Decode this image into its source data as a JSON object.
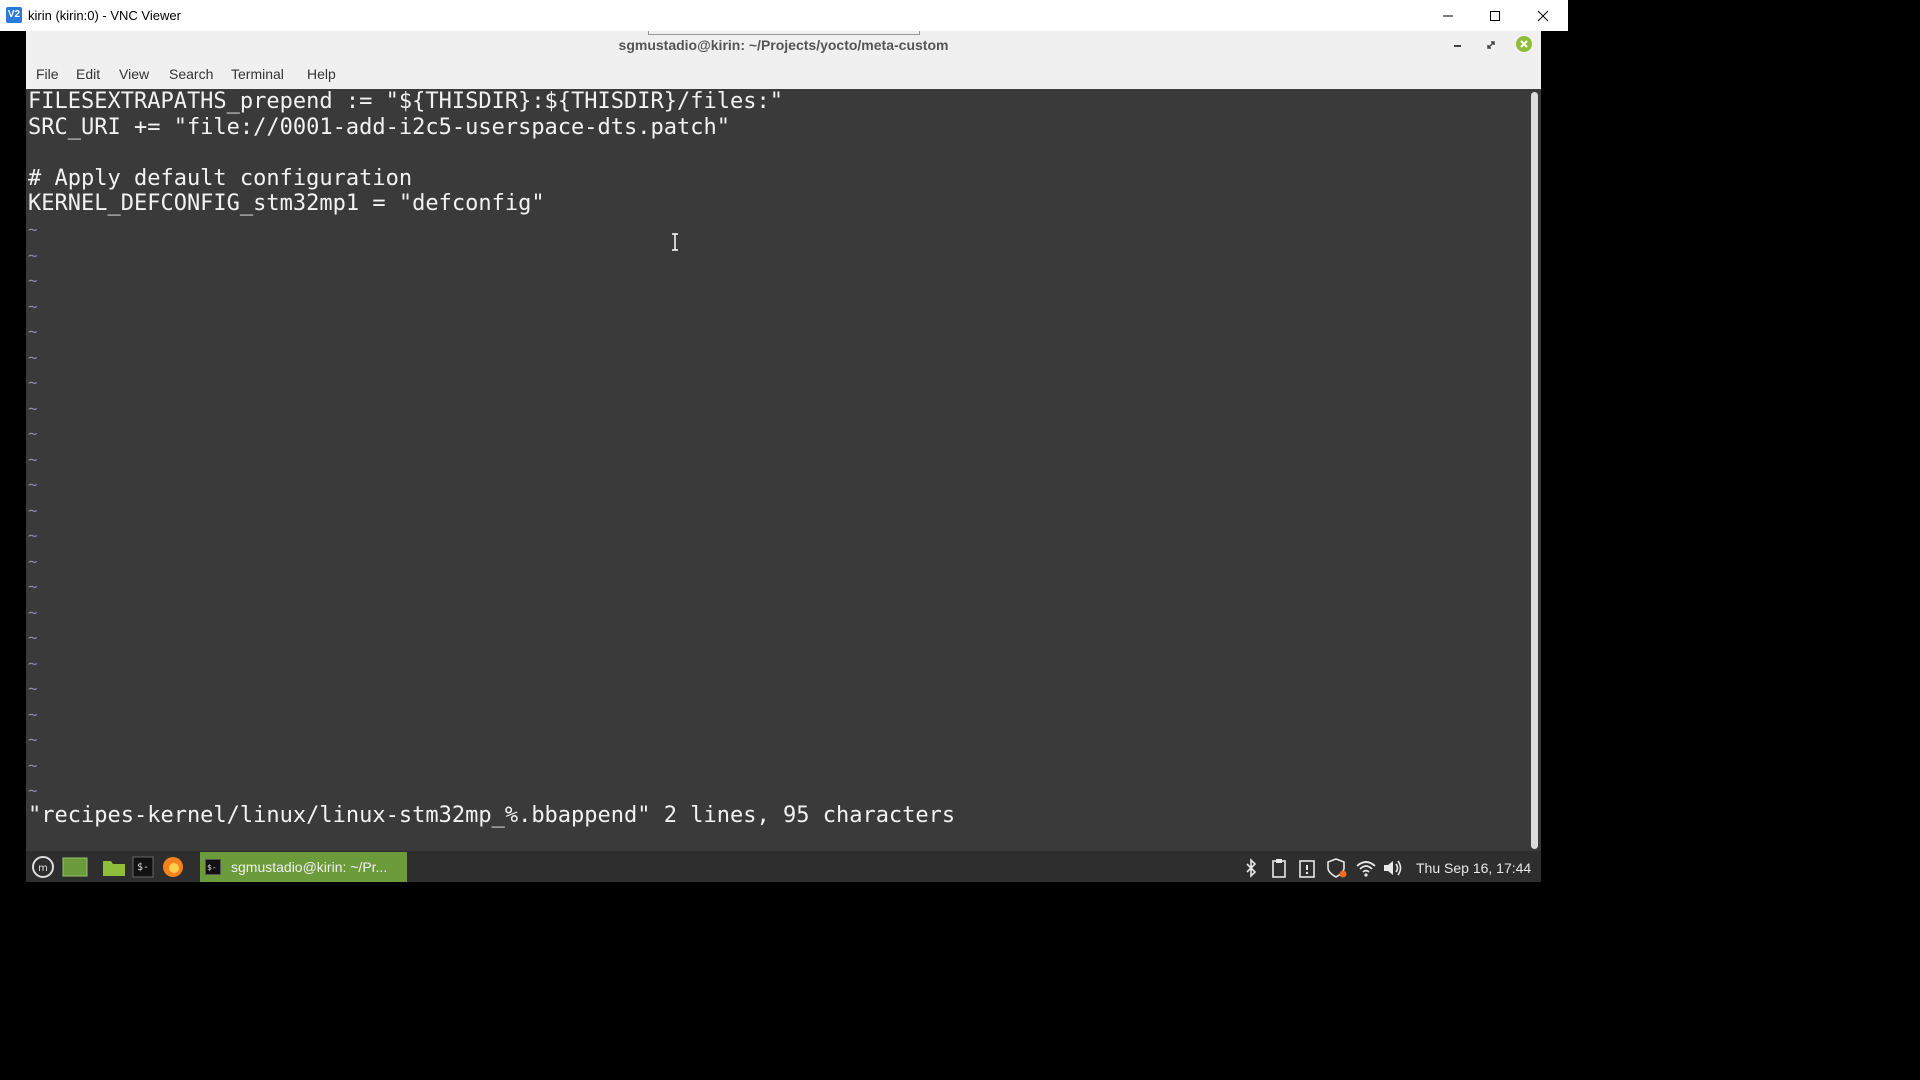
{
  "host": {
    "icon_label": "V2",
    "title": "kirin (kirin:0) - VNC Viewer"
  },
  "terminal": {
    "title": "sgmustadio@kirin: ~/Projects/yocto/meta-custom",
    "menu": [
      "File",
      "Edit",
      "View",
      "Search",
      "Terminal",
      "Help"
    ]
  },
  "editor": {
    "lines": [
      "FILESEXTRAPATHS_prepend := \"${THISDIR}:${THISDIR}/files:\"",
      "SRC_URI += \"file://0001-add-i2c5-userspace-dts.patch\"",
      "",
      "# Apply default configuration",
      "KERNEL_DEFCONFIG_stm32mp1 = \"defconfig\""
    ],
    "empty_marker": "~",
    "status": "\"recipes-kernel/linux/linux-stm32mp_%.bbappend\" 2 lines, 95 characters"
  },
  "taskbar": {
    "task_label": "sgmustadio@kirin: ~/Pr...",
    "clock": "Thu Sep 16, 17:44"
  },
  "colors": {
    "terminal_bg": "#3a3a3a",
    "text": "#f2f2f2",
    "tilde": "#8a8aa8",
    "task_active": "#6b9b3a",
    "mint_green": "#8fbf3a"
  }
}
